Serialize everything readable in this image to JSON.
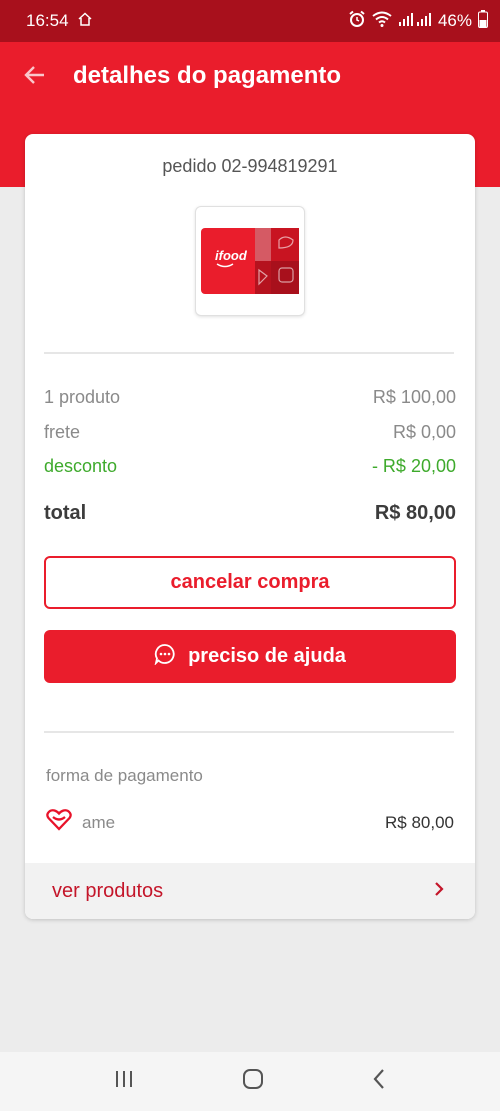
{
  "status_bar": {
    "time": "16:54",
    "battery": "46%"
  },
  "header": {
    "title": "detalhes do pagamento"
  },
  "order": {
    "id_label": "pedido 02-994819291"
  },
  "summary": {
    "products_label": "1 produto",
    "products_value": "R$ 100,00",
    "shipping_label": "frete",
    "shipping_value": "R$ 0,00",
    "discount_label": "desconto",
    "discount_value": "- R$ 20,00",
    "total_label": "total",
    "total_value": "R$ 80,00"
  },
  "actions": {
    "cancel_label": "cancelar compra",
    "help_label": "preciso de ajuda"
  },
  "payment": {
    "section_label": "forma de pagamento",
    "method": "ame",
    "amount": "R$ 80,00"
  },
  "products_link": {
    "label": "ver produtos"
  },
  "colors": {
    "brand_red": "#ea1d2c",
    "status_red": "#a8101c",
    "discount_green": "#3eaa2c"
  },
  "icons": [
    "home-icon",
    "alarm-icon",
    "wifi-icon",
    "signal-icon",
    "battery-icon",
    "back-arrow-icon",
    "chat-icon",
    "ame-heart-icon",
    "chevron-right-icon",
    "recent-apps-icon",
    "home-nav-icon",
    "back-nav-icon"
  ]
}
